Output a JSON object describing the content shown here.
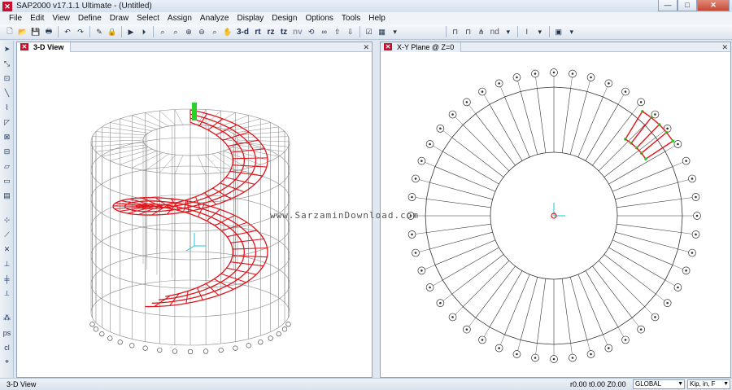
{
  "window": {
    "title": "SAP2000 v17.1.1 Ultimate  - (Untitled)",
    "controls": [
      "—",
      "□",
      "✕"
    ]
  },
  "menu": [
    "File",
    "Edit",
    "View",
    "Define",
    "Draw",
    "Select",
    "Assign",
    "Analyze",
    "Display",
    "Design",
    "Options",
    "Tools",
    "Help"
  ],
  "toolbar": {
    "view_labels": [
      "3-d",
      "rt",
      "rz",
      "tz",
      "nv"
    ],
    "nd_label": "nd"
  },
  "panes": {
    "left_tab": "3-D View",
    "right_tab": "X-Y Plane @ Z=0",
    "close_glyph": "✕"
  },
  "watermark": "www.SarzaminDownload.com",
  "status": {
    "left": "3-D View",
    "coords": "r0.00  t0.00  Z0.00",
    "coord_system": "GLOBAL",
    "units": "Kip, in, F"
  },
  "colors": {
    "member_red": "#e0141b",
    "frame_grey": "#8c8c8c",
    "support_green": "#2bd12b",
    "axis_cyan": "#12c7d8"
  }
}
